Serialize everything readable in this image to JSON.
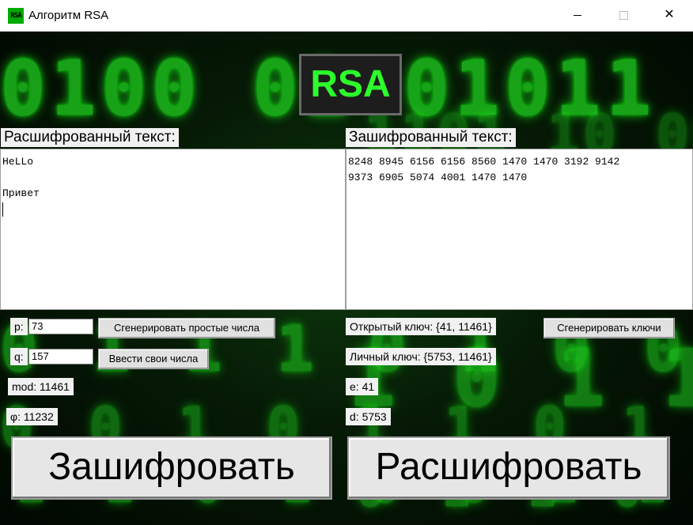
{
  "window": {
    "title": "Алгоритм RSA",
    "icon_text": "RSA",
    "controls": {
      "minimize": "",
      "maximize": "",
      "close": "✕"
    }
  },
  "logo": {
    "text": "RSA"
  },
  "left_panel": {
    "label": "Расшифрованный текст:",
    "text": "HeLLo\n\nПривет\n"
  },
  "right_panel": {
    "label": "Зашифрованный текст:",
    "text": "8248 8945 6156 6156 8560 1470 1470 3192 9142\n9373 6905 5074 4001 1470 1470"
  },
  "params": {
    "p_label": "p:",
    "p_value": "73",
    "q_label": "q:",
    "q_value": "157",
    "mod_text": "mod:  11461",
    "phi_text": "φ: 11232",
    "gen_primes_button": "Сгенерировать простые числа",
    "enter_own_button": "Ввести свои числа"
  },
  "keys": {
    "public_key": "Открытый ключ: {41, 11461}",
    "private_key": "Личный ключ: {5753, 11461}",
    "e_text": "e: 41",
    "d_text": "d: 5753",
    "gen_keys_button": "Сгенерировать ключи"
  },
  "actions": {
    "encrypt_button": "Зашифровать",
    "decrypt_button": "Расшифровать"
  },
  "background_digits": [
    "0100 01 01011",
    "1101 10 0011011",
    "0 1 1 1 0 1 0 0 1",
    "1 0 1 1 1 0 1 1",
    "0 0 1 0 1 1 0 1 0",
    "1 1 0 1 0 0 1 1",
    "0 1 1 0 1 1 0 1 0"
  ],
  "colors": {
    "matrix_green": "#1fd21f",
    "logo_green": "#2cff2c",
    "chip_bg": "#f1f1f1"
  }
}
